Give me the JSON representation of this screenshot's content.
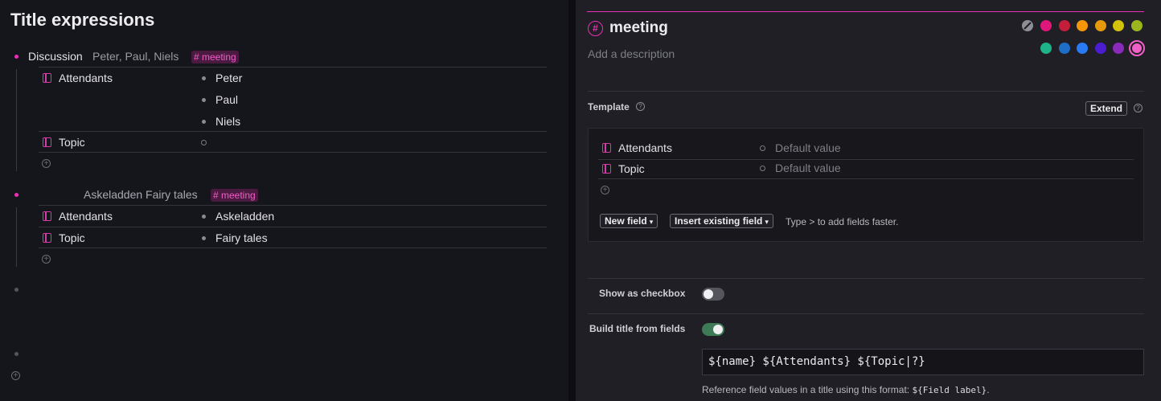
{
  "left": {
    "page_title": "Title expressions",
    "node1": {
      "name": "Discussion",
      "title_suffix": "Peter, Paul, Niels",
      "tag": "# meeting",
      "fields": [
        {
          "label": "Attendants",
          "values": [
            "Peter",
            "Paul",
            "Niels"
          ]
        },
        {
          "label": "Topic",
          "values": []
        }
      ]
    },
    "node2": {
      "title": "Askeladden Fairy tales",
      "tag": "# meeting",
      "fields": [
        {
          "label": "Attendants",
          "values": [
            "Askeladden"
          ]
        },
        {
          "label": "Topic",
          "values": [
            "Fairy tales"
          ]
        }
      ]
    },
    "add_icon": "plus-circle-icon"
  },
  "right": {
    "tag_name": "meeting",
    "description_placeholder": "Add a description",
    "colors": {
      "row1": [
        "#e0177a",
        "#c41e3a",
        "#f5960a",
        "#e39a0c",
        "#d4c10a",
        "#9ab51e"
      ],
      "row2": [
        "#1fb38a",
        "#1e6ec8",
        "#2a7af5",
        "#4a1ed0",
        "#8a2ab8"
      ],
      "selected": "#f060c8",
      "accent": "#e92fb5"
    },
    "template": {
      "label": "Template",
      "extend_label": "Extend",
      "fields": [
        {
          "label": "Attendants",
          "placeholder": "Default value"
        },
        {
          "label": "Topic",
          "placeholder": "Default value"
        }
      ],
      "new_field_label": "New field",
      "insert_existing_label": "Insert existing field",
      "hint": "Type > to add fields faster."
    },
    "show_as_checkbox": {
      "label": "Show as checkbox",
      "enabled": false
    },
    "build_title": {
      "label": "Build title from fields",
      "enabled": true,
      "expression": "${name} ${Attendants} ${Topic|?}",
      "help_prefix": "Reference field values in a title using this format: ",
      "help_code": "${Field label}",
      "help_suffix": "."
    }
  }
}
